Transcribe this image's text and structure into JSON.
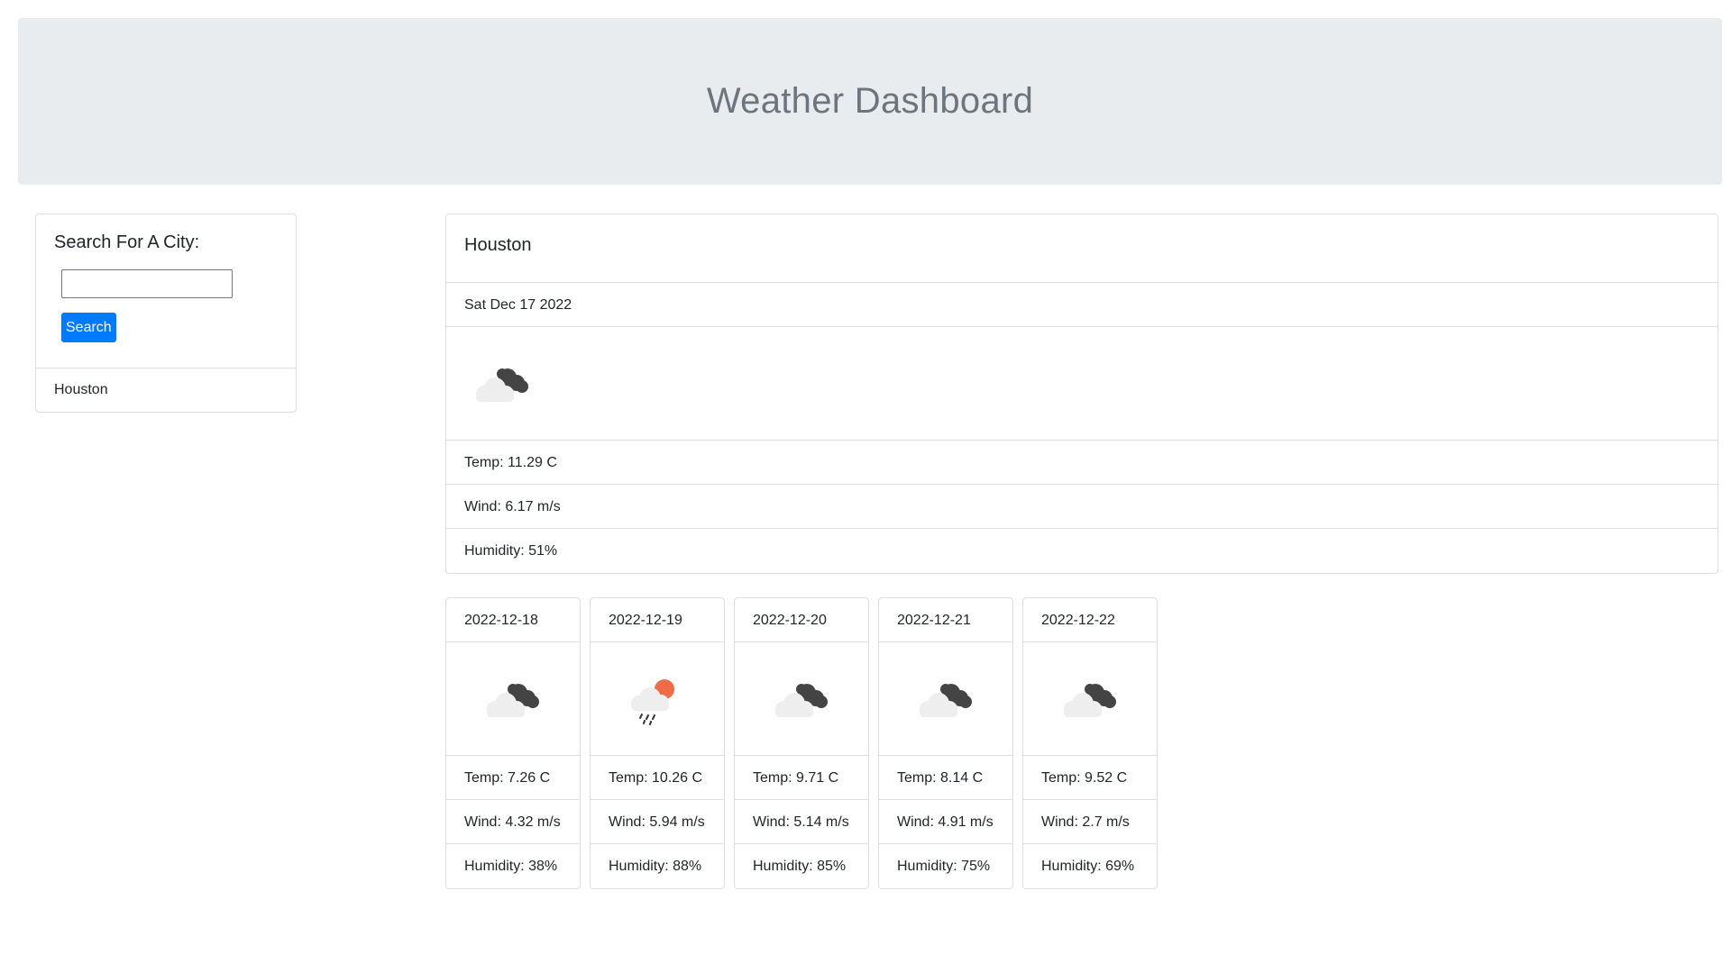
{
  "header": {
    "title": "Weather Dashboard"
  },
  "sidebar": {
    "search_title": "Search For A City:",
    "search_value": "",
    "search_button": "Search",
    "history": [
      "Houston"
    ]
  },
  "current": {
    "city": "Houston",
    "date": "Sat Dec 17 2022",
    "icon": "cloudy-night-icon",
    "temp": "Temp: 11.29 C",
    "wind": "Wind: 6.17 m/s",
    "humidity": "Humidity: 51%"
  },
  "forecast": [
    {
      "date": "2022-12-18",
      "icon": "cloudy-night-icon",
      "temp": "Temp: 7.26 C",
      "wind": "Wind: 4.32 m/s",
      "humidity": "Humidity: 38%"
    },
    {
      "date": "2022-12-19",
      "icon": "rain-sun-icon",
      "temp": "Temp: 10.26 C",
      "wind": "Wind: 5.94 m/s",
      "humidity": "Humidity: 88%"
    },
    {
      "date": "2022-12-20",
      "icon": "cloudy-night-icon",
      "temp": "Temp: 9.71 C",
      "wind": "Wind: 5.14 m/s",
      "humidity": "Humidity: 85%"
    },
    {
      "date": "2022-12-21",
      "icon": "cloudy-night-icon",
      "temp": "Temp: 8.14 C",
      "wind": "Wind: 4.91 m/s",
      "humidity": "Humidity: 75%"
    },
    {
      "date": "2022-12-22",
      "icon": "cloudy-night-icon",
      "temp": "Temp: 9.52 C",
      "wind": "Wind: 2.7 m/s",
      "humidity": "Humidity: 69%"
    }
  ],
  "colors": {
    "accent": "#007bff",
    "header_bg": "#e9ecef",
    "header_text": "#6c757d",
    "border": "#dfdfdf"
  }
}
